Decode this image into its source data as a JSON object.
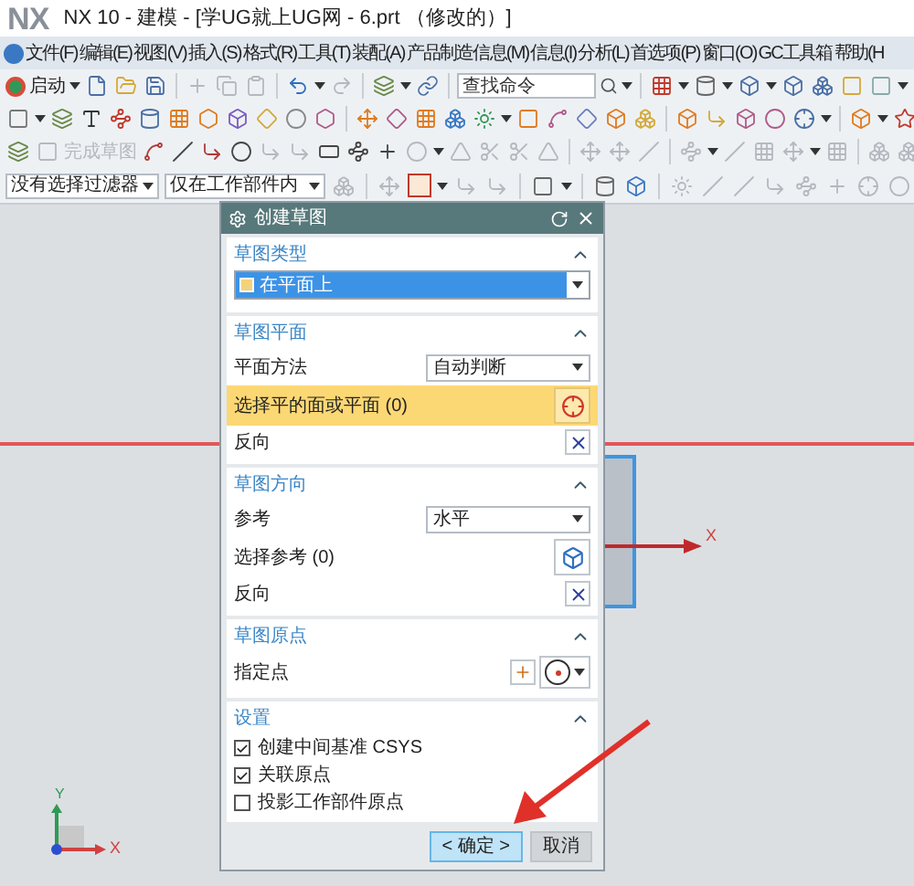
{
  "window": {
    "logo": "NX",
    "title": "NX 10 - 建模 - [学UG就上UG网 - 6.prt （修改的）]"
  },
  "menu": [
    "文件(F)",
    "编辑(E)",
    "视图(V)",
    "插入(S)",
    "格式(R)",
    "工具(T)",
    "装配(A)",
    "产品制造信息(M)",
    "信息(I)",
    "分析(L)",
    "首选项(P)",
    "窗口(O)",
    "GC工具箱",
    "帮助(H"
  ],
  "toolbar": {
    "start_label": "启动",
    "search": {
      "placeholder": "查找命令"
    },
    "finish_sketch": {
      "label": "完成草图",
      "disabled": true
    },
    "filters": [
      "没有选择过滤器",
      "仅在工作部件内"
    ]
  },
  "dialog": {
    "title": "创建草图",
    "sections": [
      {
        "title": "草图类型",
        "expanded": true,
        "rows": [
          {
            "kind": "select",
            "value": "在平面上"
          }
        ]
      },
      {
        "title": "草图平面",
        "expanded": true,
        "rows": [
          {
            "kind": "dropdown",
            "label": "平面方法",
            "value": "自动判断"
          },
          {
            "kind": "face_selector",
            "label": "选择平的面或平面 (0)",
            "active": true
          },
          {
            "kind": "reverse",
            "label": "反向"
          }
        ]
      },
      {
        "title": "草图方向",
        "expanded": true,
        "rows": [
          {
            "kind": "dropdown",
            "label": "参考",
            "value": "水平"
          },
          {
            "kind": "reference_selector",
            "label": "选择参考 (0)",
            "active": false
          },
          {
            "kind": "reverse",
            "label": "反向"
          }
        ]
      },
      {
        "title": "草图原点",
        "expanded": true,
        "rows": [
          {
            "kind": "point",
            "label": "指定点"
          }
        ]
      },
      {
        "title": "设置",
        "expanded": true,
        "rows": [
          {
            "kind": "checkbox",
            "label": "创建中间基准 CSYS",
            "checked": true
          },
          {
            "kind": "checkbox",
            "label": "关联原点",
            "checked": true
          },
          {
            "kind": "checkbox",
            "label": "投影工作部件原点",
            "checked": false
          }
        ]
      }
    ],
    "buttons": [
      {
        "kind": "ok",
        "label": "< 确定 >"
      },
      {
        "kind": "cancel",
        "label": "取消"
      }
    ]
  },
  "canvas": {
    "plane_axis_label": "X",
    "triad": {
      "x_label": "X",
      "y_label": "Y"
    }
  }
}
